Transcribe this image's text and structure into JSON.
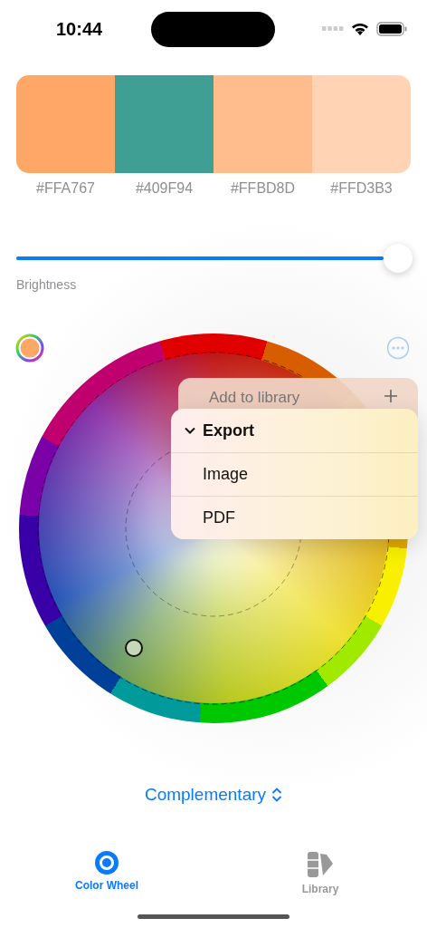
{
  "status_bar": {
    "time": "10:44"
  },
  "swatches": [
    {
      "hex": "#FFA767",
      "color": "#ffa767"
    },
    {
      "hex": "#409F94",
      "color": "#409f94"
    },
    {
      "hex": "#FFBD8D",
      "color": "#ffbd8d"
    },
    {
      "hex": "#FFD3B3",
      "color": "#ffd3b3"
    }
  ],
  "brightness": {
    "label": "Brightness",
    "level": 1
  },
  "menu": {
    "add_item": {
      "label": "Add to library"
    },
    "export": {
      "label": "Export",
      "expanded": true,
      "items": [
        {
          "label": "Image"
        },
        {
          "label": "PDF"
        }
      ]
    }
  },
  "harmony_picker": {
    "label": "Complementary"
  },
  "tabs": [
    {
      "label": "Color Wheel",
      "selected": true
    },
    {
      "label": "Library",
      "selected": false
    }
  ]
}
